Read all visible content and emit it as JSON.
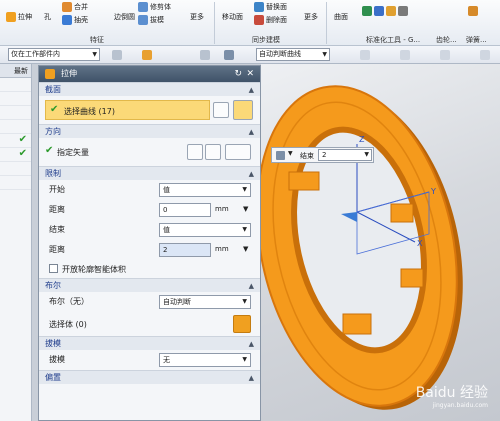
{
  "ribbon": {
    "row1": {
      "extrude": "拉伸",
      "hole": "孔",
      "unite": "合并",
      "shell": "抽壳",
      "edge_blend": "边倒圆",
      "trim_body": "修剪体",
      "draft": "拔模",
      "more1": "更多",
      "move_face": "移动面",
      "replace_face": "替换面",
      "delete_face": "删除面",
      "more2": "更多",
      "surface": "曲面"
    },
    "groups": {
      "feature": "特征",
      "sync_modeling": "同步建模",
      "std_parts": "标准化工具 - G...",
      "gear": "齿轮...",
      "spring": "弹簧..."
    }
  },
  "toolbar2": {
    "scope": "仅在工作部件内",
    "curve_rule": "自动判断曲线"
  },
  "leftnav": {
    "header": "最新"
  },
  "dialog": {
    "title": "拉伸",
    "section": {
      "title": "截面",
      "select_curve": "选择曲线 (17)"
    },
    "direction": {
      "title": "方向",
      "vector": "指定矢量"
    },
    "limits": {
      "title": "限制",
      "start_label": "开始",
      "start_value": "值",
      "distance_label": "距离",
      "distance1": "0",
      "unit": "mm",
      "end_label": "结束",
      "end_value": "值",
      "distance2_label": "距离",
      "distance2": "2",
      "open_profile": "开放轮廓智能体积"
    },
    "boolean": {
      "title": "布尔",
      "label": "布尔（无）",
      "value": "自动判断",
      "select_body": "选择体 (0)"
    },
    "draft": {
      "title": "拔模",
      "label": "拔模",
      "value": "无"
    },
    "offset_title": "偏置"
  },
  "float": {
    "end_label": "结束",
    "end_value": "2"
  },
  "watermark": {
    "text": "Baidu 经验",
    "sub": "jingyan.baidu.com"
  },
  "colors": {
    "ring": "#f59a1c",
    "ring_dark": "#d8760c",
    "title_bar": "#4a5d73",
    "highlight": "#fbd978"
  }
}
